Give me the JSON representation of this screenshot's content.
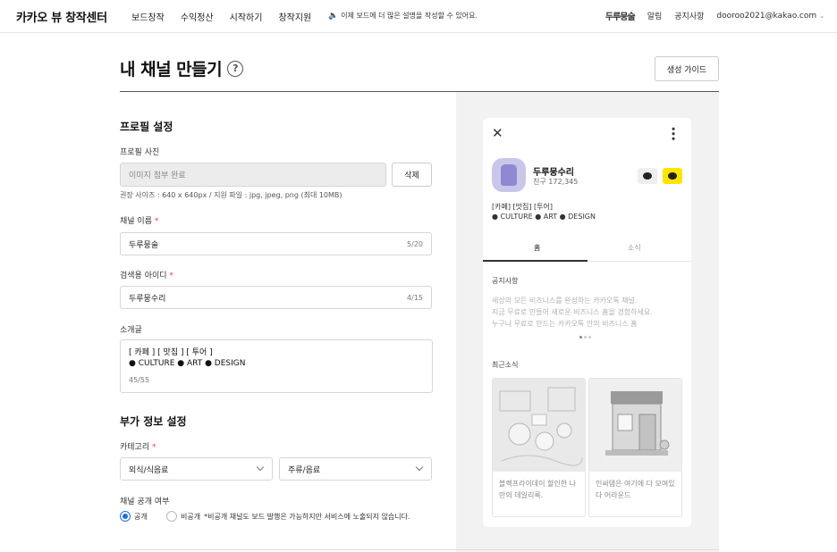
{
  "header": {
    "logo": "카카오 뷰 창작센터",
    "nav": [
      "보드창작",
      "수익정산",
      "시작하기",
      "창작지원"
    ],
    "notice": "이제 보드에 더 많은 설명을 작성할 수 있어요.",
    "brand_mini": "두루뭉술",
    "alarm": "알림",
    "announcements": "공지사항",
    "account": "dooroo2021@kakao.com"
  },
  "page": {
    "title": "내 채널 만들기",
    "help": "?",
    "guide_button": "생성 가이드"
  },
  "profile": {
    "section_title": "프로필 설정",
    "photo_label": "프로필 사진",
    "photo_value": "이미지 첨부 완료",
    "delete_button": "삭제",
    "photo_hint": "권장 사이즈 : 640 x 640px / 지원 파일 : jpg, jpeg, png (최대 10MB)",
    "name_label": "채널 이름",
    "name_value": "두루뭉술",
    "name_count": "5/20",
    "id_label": "검색용 아이디",
    "id_value": "두루뭉수리",
    "id_count": "4/15",
    "intro_label": "소개글",
    "intro_line1": "[ 카페 ] [ 맛집 ] [ 투어 ]",
    "intro_line2": "● CULTURE ● ART ● DESIGN",
    "intro_count": "45/55",
    "required_mark": "*"
  },
  "extra": {
    "section_title": "부가 정보 설정",
    "category_label": "카테고리",
    "category1": "외식/식음료",
    "category2": "주류/음료",
    "visibility_label": "채널 공개 여부",
    "public": "공개",
    "private": "비공개",
    "private_note": "*비공개 채널도 보드 발행은 가능하지만 서비스에 노출되지 않습니다."
  },
  "preview": {
    "close": "✕",
    "more": "⋮",
    "name": "두루뭉수리",
    "friends": "친구 172,345",
    "desc1": "[카페] [맛집] [투어]",
    "desc2": "● CULTURE ● ART ● DESIGN",
    "tab_home": "홈",
    "tab_news": "소식",
    "notice_title": "공지사항",
    "notice_lines": [
      "세상의 모든 비즈니스를 완성하는 카카오톡 채널.",
      "지금 무료로 만들어 새로운 비즈니스 홈을 경험하세요.",
      "누구나 무료로 만드는 카카오톡 안의 비즈니스 홈"
    ],
    "recent_title": "최근소식",
    "cards": [
      {
        "caption": "블랙프라이데이 할인한 나만의 데일리룩."
      },
      {
        "caption": "인싸템은 여기에 다 모여있다 어라운드"
      }
    ]
  }
}
